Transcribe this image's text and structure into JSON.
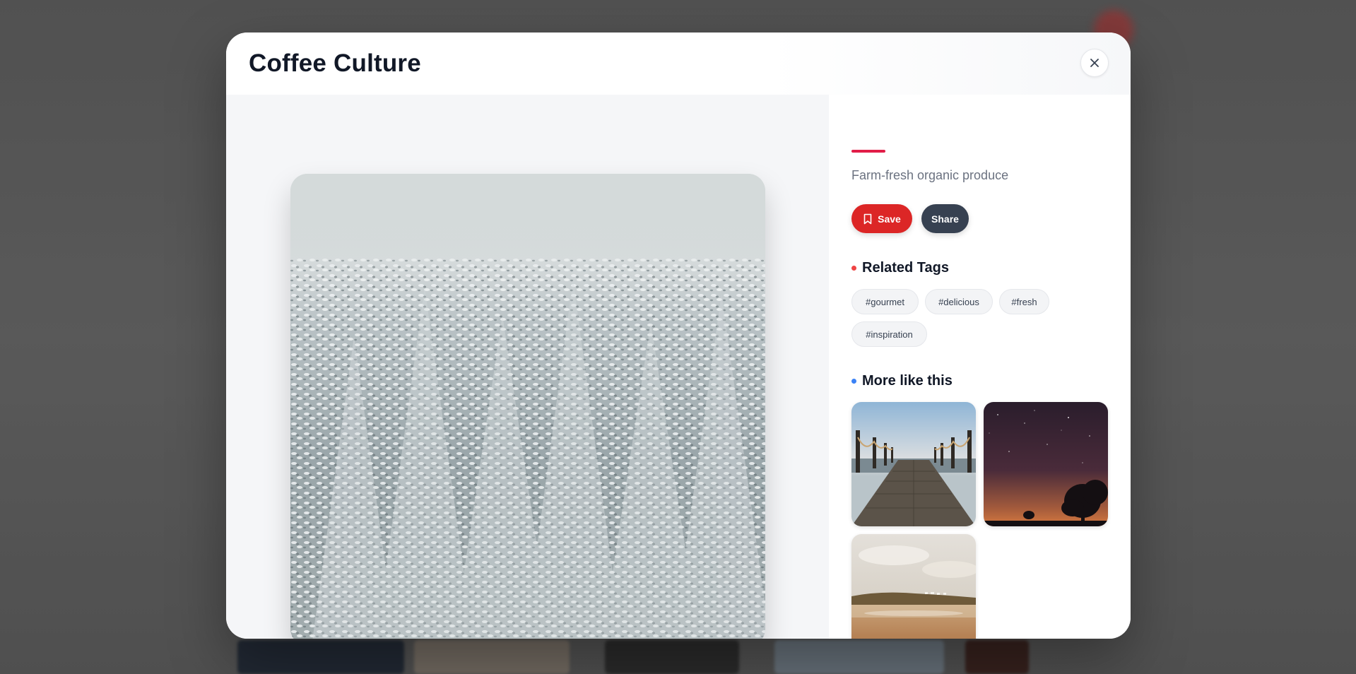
{
  "modal": {
    "title": "Coffee Culture",
    "description": "Farm-fresh organic produce",
    "actions": {
      "save_label": "Save",
      "share_label": "Share"
    },
    "related_tags": {
      "heading": "Related Tags",
      "tags": [
        "#gourmet",
        "#delicious",
        "#fresh",
        "#inspiration"
      ]
    },
    "more_like_this": {
      "heading": "More like this",
      "items": [
        {
          "icon": "pier-photo"
        },
        {
          "icon": "night-sky-photo"
        },
        {
          "icon": "beach-photo"
        }
      ]
    }
  },
  "icons": {
    "close": "close-icon",
    "save": "bookmark-icon"
  },
  "colors": {
    "accent": "#e11d48",
    "save_button": "#dc2626",
    "share_button": "#374151",
    "tags_dot": "#ef4444",
    "more_dot": "#3b82f6"
  }
}
